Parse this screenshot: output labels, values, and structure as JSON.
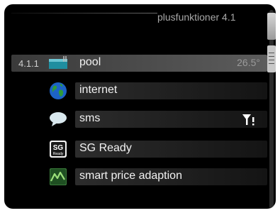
{
  "header": {
    "title": "plusfunktioner 4.1"
  },
  "items": [
    {
      "number": "4.1.1",
      "label": "pool",
      "value": "26.5°",
      "icon": "pool-icon",
      "selected": true
    },
    {
      "label": "internet",
      "icon": "globe-icon"
    },
    {
      "label": "sms",
      "icon": "speech-bubble-icon",
      "status_icon": "signal-antenna-warning-icon"
    },
    {
      "label": "SG Ready",
      "icon": "sg-ready-icon",
      "icon_text_top": "SG",
      "icon_text_bottom": "Ready"
    },
    {
      "label": "smart price adaption",
      "icon": "price-graph-icon"
    }
  ],
  "colors": {
    "background": "#000000",
    "text": "#f2f2f2",
    "selected_bar": "#4a4a4a",
    "muted_text": "#9a9a9a"
  }
}
